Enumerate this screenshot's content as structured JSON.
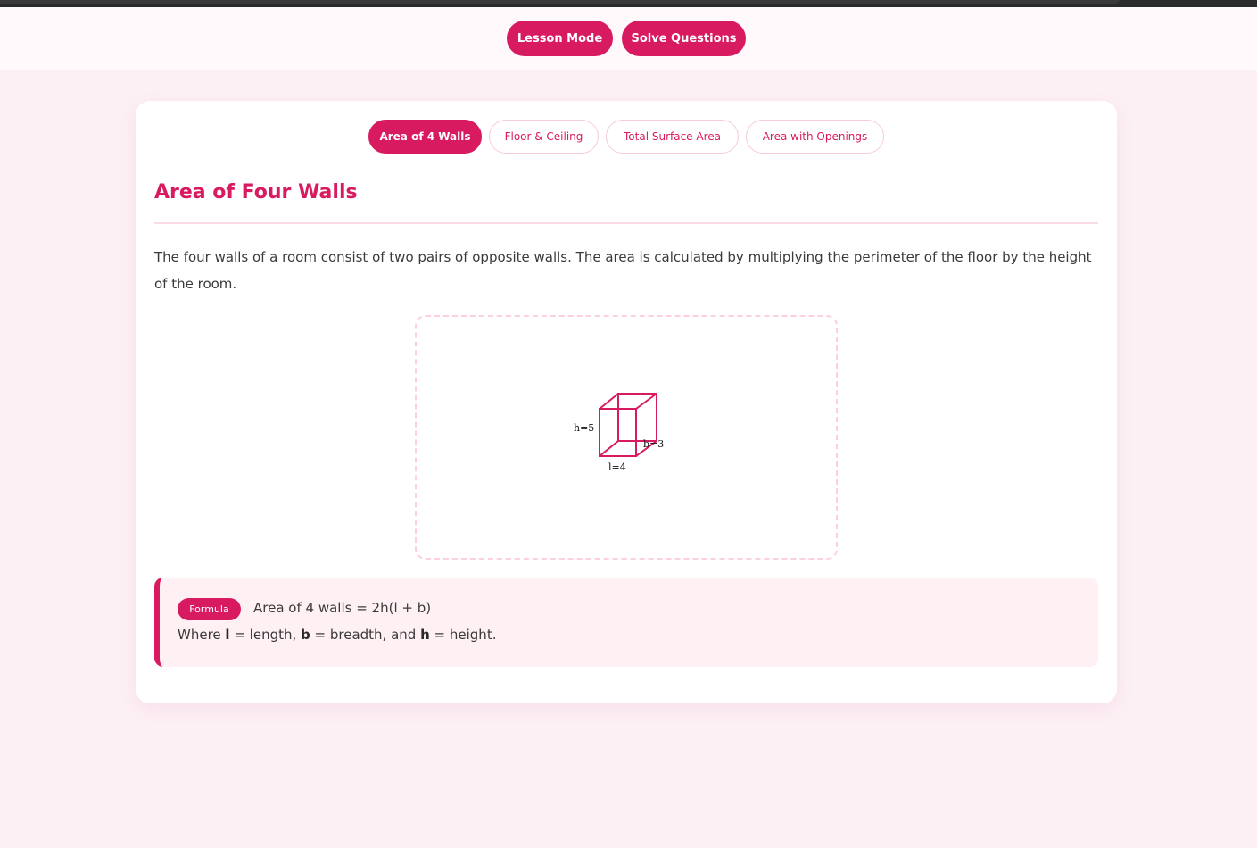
{
  "header": {
    "lesson_mode": "Lesson Mode",
    "solve_questions": "Solve Questions"
  },
  "tabs": [
    {
      "label": "Area of 4 Walls",
      "active": true
    },
    {
      "label": "Floor & Ceiling",
      "active": false
    },
    {
      "label": "Total Surface Area",
      "active": false
    },
    {
      "label": "Area with Openings",
      "active": false
    }
  ],
  "lesson": {
    "title": "Area of Four Walls",
    "description": "The four walls of a room consist of two pairs of opposite walls. The area is calculated by multiplying the perimeter of the floor by the height of the room."
  },
  "diagram": {
    "height_label": "h=5",
    "breadth_label": "b=3",
    "length_label": "l=4"
  },
  "formula": {
    "badge": "Formula",
    "expression": "Area of 4 walls = 2h(l + b)",
    "where_prefix": "Where ",
    "l_symbol": "l",
    "l_text": " = length, ",
    "b_symbol": "b",
    "b_text": " = breadth, and ",
    "h_symbol": "h",
    "h_text": " = height."
  },
  "colors": {
    "accent": "#d81b60",
    "page_bg": "#fcf0f5",
    "formula_bg": "#fff0f4"
  }
}
